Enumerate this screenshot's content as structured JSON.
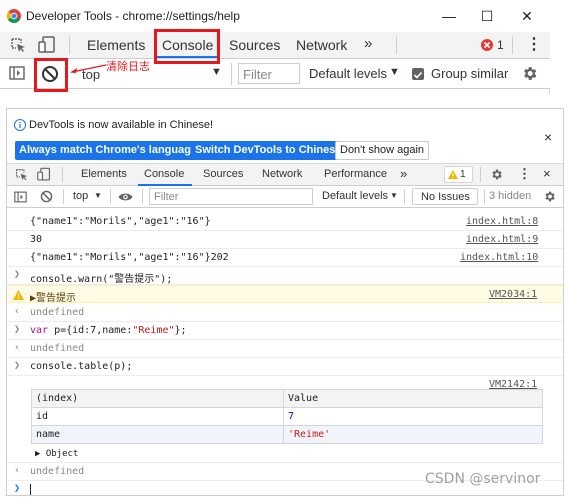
{
  "top": {
    "window_title": "Developer Tools - chrome://settings/help",
    "tabs": [
      "Elements",
      "Console",
      "Sources",
      "Network"
    ],
    "more": "»",
    "error_count": "1",
    "context": "top",
    "filter_placeholder": "Filter",
    "levels": "Default levels",
    "group_similar": "Group similar",
    "annotation": "清除日志"
  },
  "devtools": {
    "info_text": "DevTools is now available in Chinese!",
    "btn_match": "Always match Chrome's language",
    "btn_switch": "Switch DevTools to Chinese",
    "btn_dont": "Don't show again",
    "tabs": [
      "Elements",
      "Console",
      "Sources",
      "Network",
      "Performance"
    ],
    "more": "»",
    "warn_count": "1",
    "context": "top",
    "filter_placeholder": "Filter",
    "levels": "Default levels",
    "issues": "No Issues",
    "hidden": "3 hidden",
    "close": "×"
  },
  "console": {
    "rows": [
      {
        "text": "{\"name1\":\"Morils\",\"age1\":\"16\"}",
        "src": "index.html:8"
      },
      {
        "text": "30",
        "src": "index.html:9"
      },
      {
        "text": "{\"name1\":\"Morils\",\"age1\":\"16\"}202",
        "src": "index.html:10"
      },
      {
        "text": "console.warn(\"警告提示\");"
      },
      {
        "text": "▶警告提示",
        "src": "VM2034:1"
      },
      {
        "text": "undefined"
      },
      {
        "text_kw": "var",
        "text_rest": " p={id:7,name:",
        "text_str": "\"Reime\"",
        "text_end": "};"
      },
      {
        "text": "undefined"
      },
      {
        "text": "console.table(p);"
      },
      {
        "src": "VM2142:1"
      }
    ],
    "table": {
      "headers": [
        "(index)",
        "Value"
      ],
      "rows": [
        [
          "id",
          "7"
        ],
        [
          "name",
          "'Reime'"
        ]
      ]
    },
    "object_label": "▶ Object",
    "last_undefined": "undefined",
    "prompt": "❯"
  },
  "watermark": "CSDN @servinor"
}
